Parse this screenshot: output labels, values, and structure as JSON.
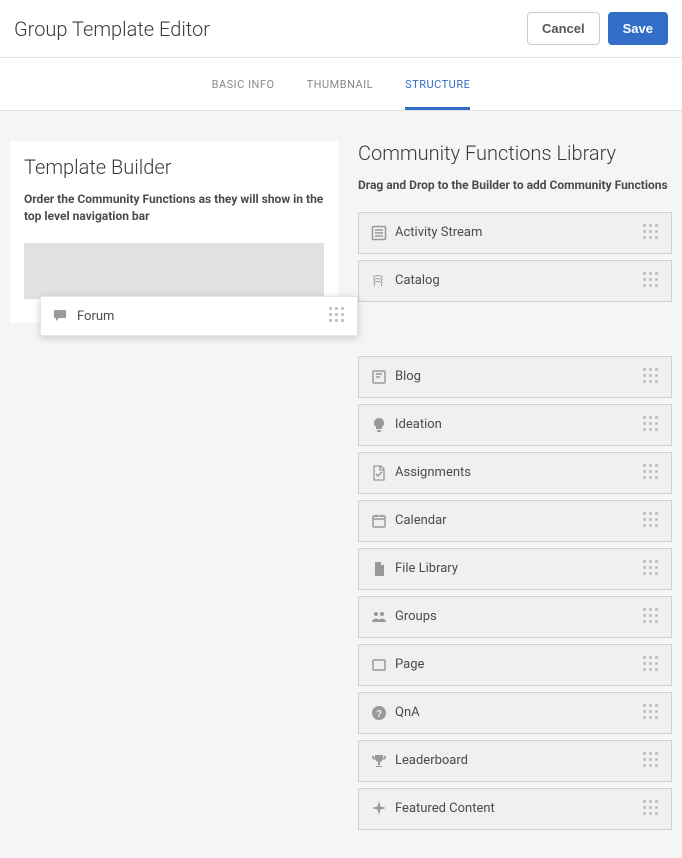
{
  "header": {
    "title": "Group Template Editor",
    "cancel": "Cancel",
    "save": "Save"
  },
  "tabs": {
    "basic_info": "Basic Info",
    "thumbnail": "Thumbnail",
    "structure": "Structure"
  },
  "builder": {
    "title": "Template Builder",
    "desc": "Order the Community Functions as they will show in the top level navigation bar",
    "items": [
      "Forum"
    ]
  },
  "library": {
    "title": "Community Functions Library",
    "desc": "Drag and Drop to the Builder to add Community Functions",
    "group1": [
      {
        "label": "Activity Stream",
        "icon": "stream"
      },
      {
        "label": "Catalog",
        "icon": "catalog"
      }
    ],
    "group2": [
      {
        "label": "Blog",
        "icon": "blog"
      },
      {
        "label": "Ideation",
        "icon": "idea"
      },
      {
        "label": "Assignments",
        "icon": "assign"
      },
      {
        "label": "Calendar",
        "icon": "calendar"
      },
      {
        "label": "File Library",
        "icon": "file"
      },
      {
        "label": "Groups",
        "icon": "groups"
      },
      {
        "label": "Page",
        "icon": "page"
      },
      {
        "label": "QnA",
        "icon": "qna"
      },
      {
        "label": "Leaderboard",
        "icon": "trophy"
      },
      {
        "label": "Featured Content",
        "icon": "star"
      }
    ]
  }
}
